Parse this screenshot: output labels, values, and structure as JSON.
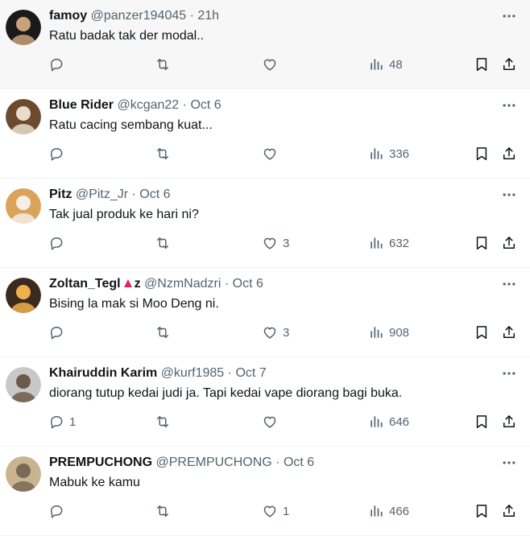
{
  "feed": {
    "tweets": [
      {
        "name": "famoy",
        "handle": "@panzer194045",
        "dot": "·",
        "time": "21h",
        "text": "Ratu badak tak der modal..",
        "replies": "",
        "retweets": "",
        "likes": "",
        "views": "48",
        "avatar_colors": [
          "#1a1a1a",
          "#c9a27c"
        ]
      },
      {
        "name": "Blue Rider",
        "handle": "@kcgan22",
        "dot": "·",
        "time": "Oct 6",
        "text": "Ratu cacing sembang kuat...",
        "replies": "",
        "retweets": "",
        "likes": "",
        "views": "336",
        "avatar_colors": [
          "#6b4a2e",
          "#e9dccb"
        ]
      },
      {
        "name": "Pitz",
        "handle": "@Pitz_Jr",
        "dot": "·",
        "time": "Oct 6",
        "text": "Tak jual produk ke hari ni?",
        "replies": "",
        "retweets": "",
        "likes": "3",
        "views": "632",
        "avatar_colors": [
          "#d9a35a",
          "#f5efe6"
        ]
      },
      {
        "name": "Zoltan_Tegl",
        "name_suffix": "z",
        "handle": "@NzmNadzri",
        "dot": "·",
        "time": "Oct 6",
        "text": "Bising la mak si Moo Deng ni.",
        "replies": "",
        "retweets": "",
        "likes": "3",
        "views": "908",
        "avatar_colors": [
          "#3a2a20",
          "#f0b04a"
        ]
      },
      {
        "name": "Khairuddin Karim",
        "handle": "@kurf1985",
        "dot": "·",
        "time": "Oct 7",
        "text": "diorang tutup kedai judi ja. Tapi kedai vape diorang bagi buka.",
        "replies": "1",
        "retweets": "",
        "likes": "",
        "views": "646",
        "avatar_colors": [
          "#c8c8c8",
          "#6b5a4a"
        ]
      },
      {
        "name": "PREMPUCHONG",
        "handle": "@PREMPUCHONG",
        "dot": "·",
        "time": "Oct 6",
        "text": "Mabuk ke kamu",
        "replies": "",
        "retweets": "",
        "likes": "1",
        "views": "466",
        "avatar_colors": [
          "#c9b48f",
          "#7a6a55"
        ]
      }
    ]
  },
  "colors": {
    "text": "#0f1419",
    "muted": "#536471",
    "badge": "#e0245e",
    "hover_bg": "#f7f7f7"
  }
}
